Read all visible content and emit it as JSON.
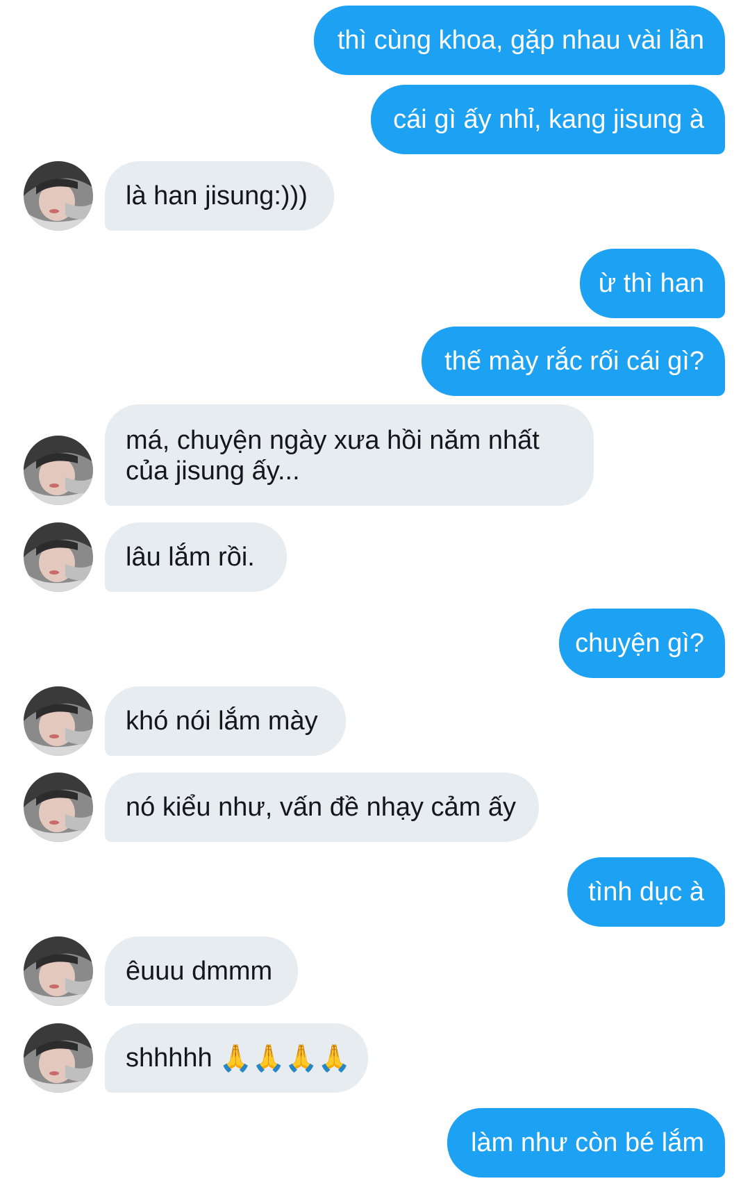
{
  "messages": [
    {
      "side": "sent",
      "text": "thì cùng khoa, gặp nhau vài lần"
    },
    {
      "side": "sent",
      "text": "cái gì ấy nhỉ, kang jisung à"
    },
    {
      "side": "received",
      "text": "là han jisung:)))"
    },
    {
      "side": "sent",
      "text": "ừ thì han"
    },
    {
      "side": "sent",
      "text": "thế mày rắc rối cái gì?"
    },
    {
      "side": "received",
      "text": "má, chuyện ngày xưa hồi năm nhất của jisung ấy..."
    },
    {
      "side": "received",
      "text": "lâu lắm rồi."
    },
    {
      "side": "sent",
      "text": "chuyện gì?"
    },
    {
      "side": "received",
      "text": "khó nói lắm mày"
    },
    {
      "side": "received",
      "text": "nó kiểu như, vấn đề nhạy cảm ấy"
    },
    {
      "side": "sent",
      "text": "tình dục à"
    },
    {
      "side": "received",
      "text": "êuuu dmmm"
    },
    {
      "side": "received",
      "text": "shhhhh",
      "emoji": "🙏🙏🙏🙏"
    },
    {
      "side": "sent",
      "text": "làm như còn bé lắm"
    }
  ],
  "colors": {
    "sent_bubble": "#1da1f2",
    "received_bubble": "#e6ecf0",
    "sent_text": "#ffffff",
    "received_text": "#14171a"
  },
  "icons": {
    "avatar": "contact-avatar",
    "emoji": "folded-hands-emoji"
  }
}
